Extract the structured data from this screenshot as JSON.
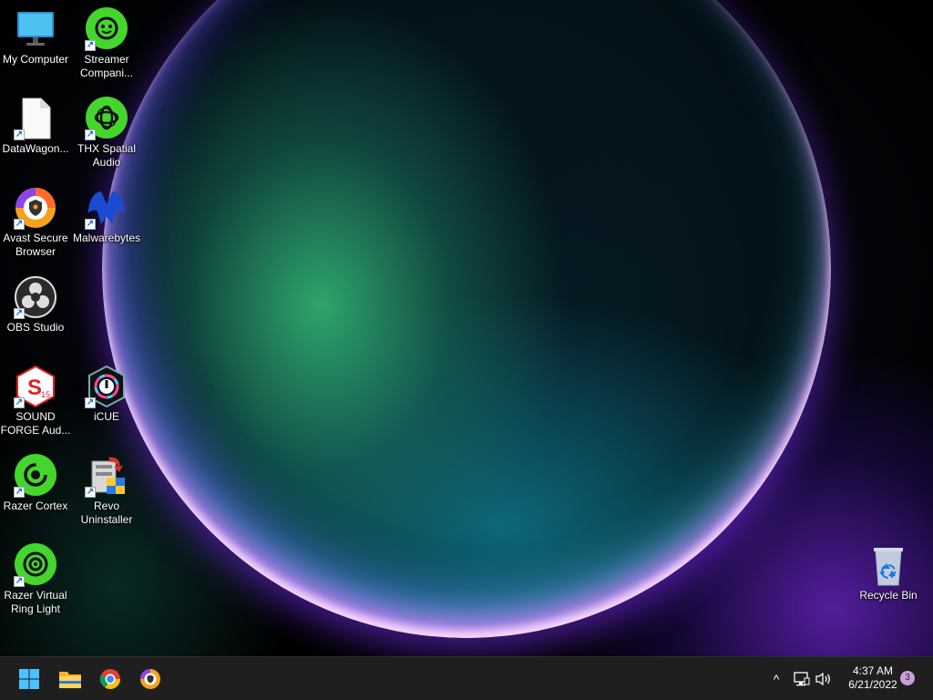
{
  "desktop": {
    "icons": [
      {
        "label": "My Computer",
        "icon": "monitor-icon",
        "shortcut": false
      },
      {
        "label": "Streamer Compani...",
        "icon": "razer-streamer-companion-icon",
        "shortcut": true
      },
      {
        "label": "DataWagon...",
        "icon": "blank-file-icon",
        "shortcut": true
      },
      {
        "label": "THX Spatial Audio",
        "icon": "thx-spatial-audio-icon",
        "shortcut": true
      },
      {
        "label": "Avast Secure Browser",
        "icon": "avast-secure-browser-icon",
        "shortcut": true
      },
      {
        "label": "Malwarebytes",
        "icon": "malwarebytes-icon",
        "shortcut": true
      },
      {
        "label": "OBS Studio",
        "icon": "obs-studio-icon",
        "shortcut": true
      },
      {
        "label": "SOUND FORGE Aud...",
        "icon": "sound-forge-icon",
        "shortcut": true
      },
      {
        "label": "iCUE",
        "icon": "icue-icon",
        "shortcut": true
      },
      {
        "label": "Razer Cortex",
        "icon": "razer-cortex-icon",
        "shortcut": true
      },
      {
        "label": "Revo Uninstaller",
        "icon": "revo-uninstaller-icon",
        "shortcut": true
      },
      {
        "label": "Razer Virtual Ring Light",
        "icon": "razer-virtual-ring-light-icon",
        "shortcut": true
      },
      {
        "label": "Recycle Bin",
        "icon": "recycle-bin-icon",
        "shortcut": false
      }
    ],
    "shortcut_arrow": "↗",
    "sound_forge_badge": "15"
  },
  "taskbar": {
    "pinned": [
      {
        "name": "start-button",
        "icon": "windows-logo-icon"
      },
      {
        "name": "file-explorer-button",
        "icon": "folder-icon"
      },
      {
        "name": "chrome-button",
        "icon": "chrome-icon"
      },
      {
        "name": "avast-browser-button",
        "icon": "avast-secure-browser-icon"
      }
    ],
    "tray": {
      "chevron": "^",
      "network_icon": "network-icon",
      "volume_icon": "volume-icon"
    },
    "clock": {
      "time": "4:37 AM",
      "date": "6/21/2022"
    },
    "notification_count": "3"
  },
  "colors": {
    "razer_green": "#44d62c",
    "taskbar_bg": "#1f1f1f",
    "notification_badge": "#c9a0dc"
  }
}
